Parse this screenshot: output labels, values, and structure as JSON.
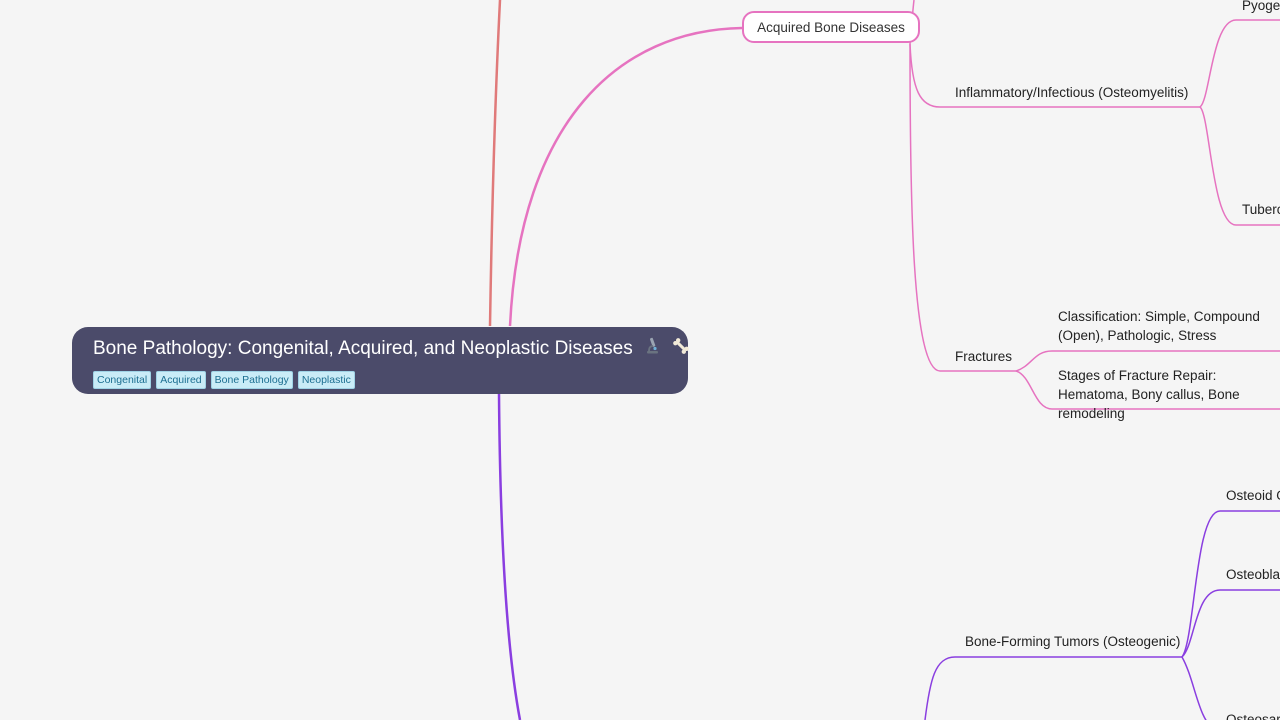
{
  "root": {
    "title": "Bone Pathology: Congenital, Acquired, and Neoplastic Diseases",
    "tags": [
      "Congenital",
      "Acquired",
      "Bone Pathology",
      "Neoplastic"
    ]
  },
  "topics": {
    "acquired": "Acquired Bone Diseases"
  },
  "branches": {
    "inflammatory": "Inflammatory/Infectious (Osteomyelitis)",
    "pyogenic": "Pyogenic",
    "tuberculous": "Tuberculous",
    "fractures": "Fractures",
    "classification": "Classification: Simple, Compound (Open), Pathologic, Stress",
    "stages": "Stages of Fracture Repair: Hematoma, Bony callus, Bone remodeling",
    "bone_forming": "Bone-Forming Tumors (Osteogenic)",
    "osteoid": "Osteoid Osteoma",
    "osteoblastoma": "Osteoblastoma",
    "osteosarcoma": "Osteosarcoma"
  },
  "colors": {
    "background": "#f5f5f5",
    "acquired_branch": "#e673c0",
    "neoplastic_branch": "#8a3ee0",
    "congenital_branch": "#e07a7a",
    "root_fill": "#4b4b6a",
    "tag_fill": "#c9ecf7"
  },
  "icons": [
    "microscope-icon",
    "bone-icon"
  ]
}
